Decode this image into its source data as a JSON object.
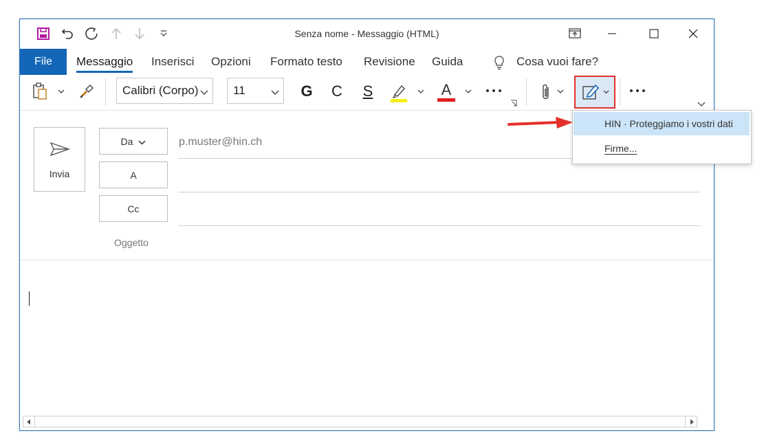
{
  "window": {
    "title": "Senza nome  -  Messaggio (HTML)"
  },
  "tabs": {
    "file": "File",
    "items": [
      "Messaggio",
      "Inserisci",
      "Opzioni",
      "Formato testo",
      "Revisione",
      "Guida"
    ],
    "active": "Messaggio",
    "search": "Cosa vuoi fare?"
  },
  "ribbon": {
    "font_name": "Calibri (Corpo)",
    "font_size": "11",
    "bold": "G",
    "italic": "C",
    "underline": "S",
    "font_color_letter": "A",
    "highlight_color": "#f4f01a",
    "font_color": "#e02020"
  },
  "signature_menu": {
    "items": [
      "HIN · Proteggiamo i vostri dati",
      "Firme..."
    ]
  },
  "compose": {
    "send_label": "Invia",
    "from_label": "Da",
    "from_value": "p.muster@hin.ch",
    "to_label": "A",
    "cc_label": "Cc",
    "subject_label": "Oggetto"
  },
  "colors": {
    "accent": "#1466b8",
    "highlight_box": "#e4302a",
    "menu_hover": "#cce4f7"
  }
}
